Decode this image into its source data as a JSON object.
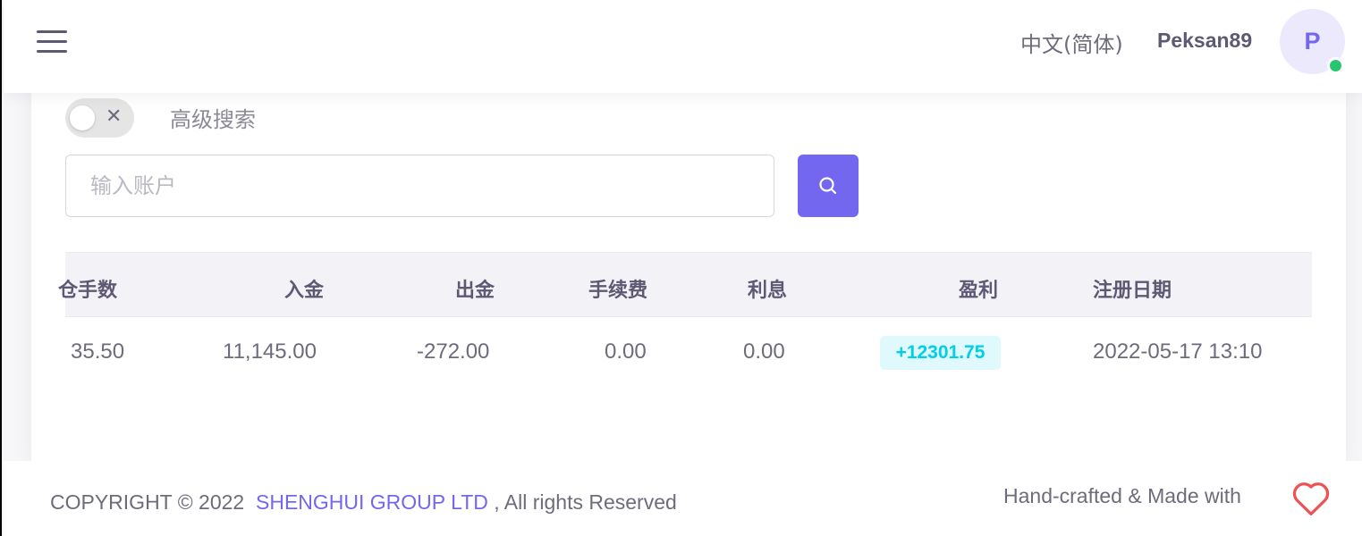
{
  "header": {
    "language": "中文(简体)",
    "username": "Peksan89",
    "avatar_initial": "P",
    "status_color": "#28c76f"
  },
  "filters": {
    "advanced_search_label": "高级搜索",
    "advanced_search_enabled": false,
    "toggle_icon": "x-icon",
    "search_placeholder": "输入账户",
    "search_value": "",
    "search_button_icon": "search-icon"
  },
  "table": {
    "headers": [
      "仓手数",
      "入金",
      "出金",
      "手续费",
      "利息",
      "盈利",
      "注册日期"
    ],
    "rows": [
      {
        "lots": "35.50",
        "deposit": "11,145.00",
        "withdrawal": "-272.00",
        "fee": "0.00",
        "interest": "0.00",
        "profit": "+12301.75",
        "register_date": "2022-05-17 13:10"
      }
    ]
  },
  "footer": {
    "copyright_prefix": "COPYRIGHT © 2022",
    "company": "SHENGHUI GROUP LTD",
    "copyright_suffix": ", All rights Reserved",
    "handcrafted": "Hand-crafted & Made with",
    "heart_icon": "heart-icon"
  },
  "colors": {
    "primary": "#7367f0",
    "profit_text": "#00cfe8",
    "profit_bg": "#e0f9fc",
    "heart": "#ea5455"
  }
}
